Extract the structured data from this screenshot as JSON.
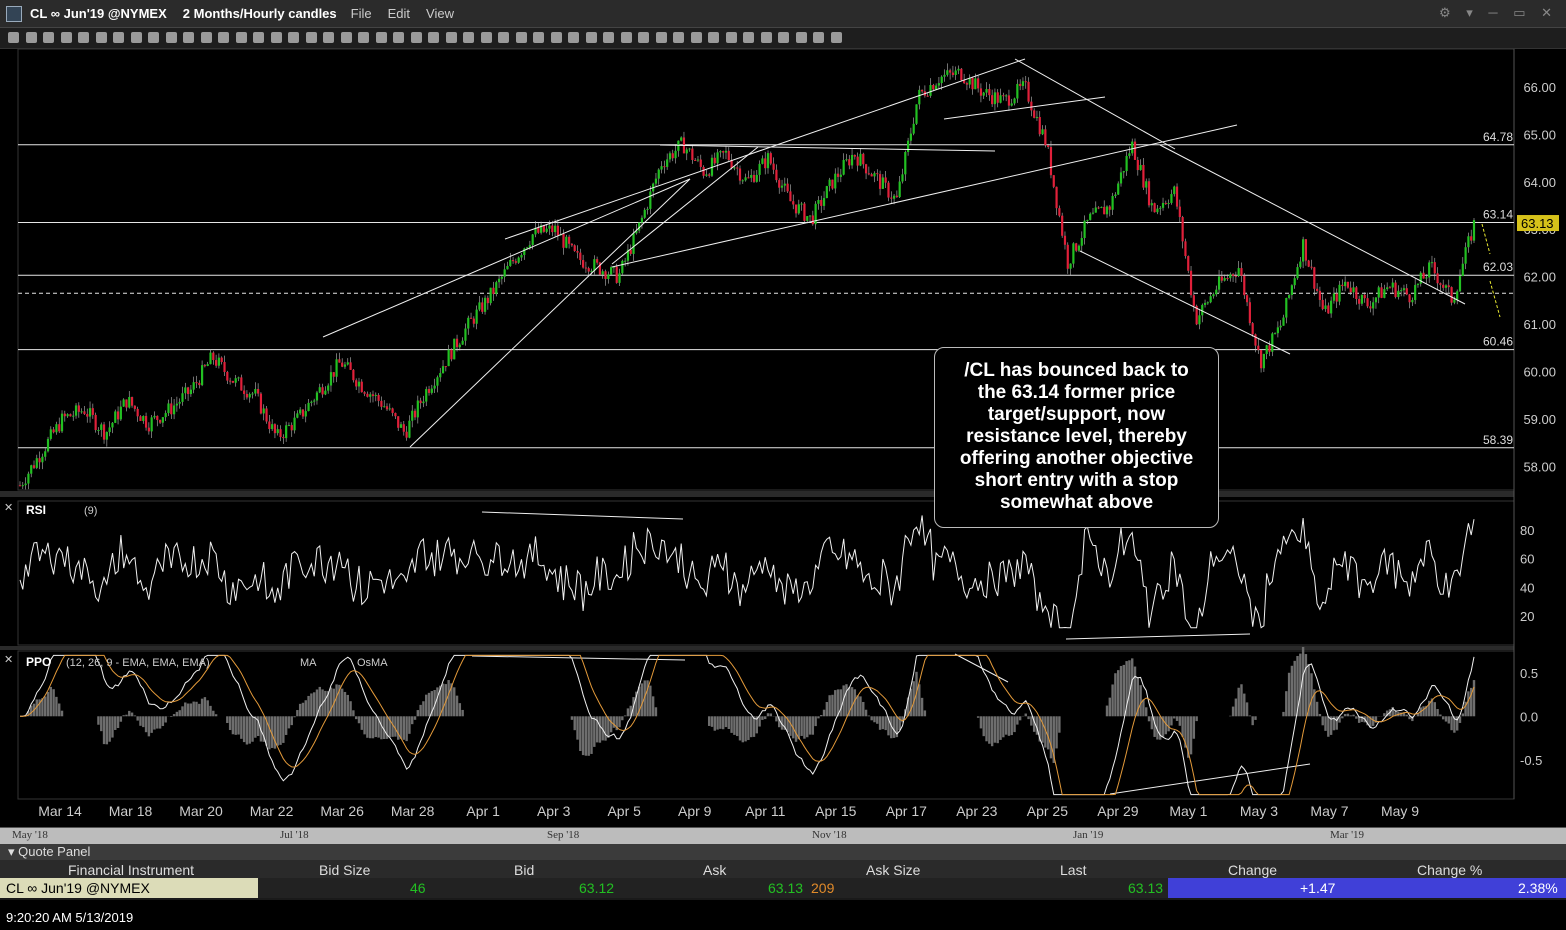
{
  "window": {
    "symbol": "CL ∞ Jun'19 @NYMEX",
    "timeframe": "2 Months/Hourly candles",
    "menus": [
      "File",
      "Edit",
      "View"
    ]
  },
  "colors": {
    "up": "#22c022",
    "down": "#e0203a",
    "bg": "#000000",
    "last_badge": "#d6c21a"
  },
  "chart_data": [
    {
      "type": "candlestick",
      "panel": "price",
      "ylim": [
        57.5,
        66.8
      ],
      "y_ticks": [
        "66.00",
        "65.00",
        "64.00",
        "63.00",
        "62.00",
        "61.00",
        "60.00",
        "59.00",
        "58.00"
      ],
      "x_tick_labels": [
        "Mar 14",
        "Mar 18",
        "Mar 20",
        "Mar 22",
        "Mar 26",
        "Mar 28",
        "Apr 1",
        "Apr 3",
        "Apr 5",
        "Apr 9",
        "Apr 11",
        "Apr 15",
        "Apr 17",
        "Apr 23",
        "Apr 25",
        "Apr 29",
        "May 1",
        "May 3",
        "May 7",
        "May 9"
      ],
      "close_path": [
        57.6,
        58.3,
        59.0,
        59.2,
        58.7,
        59.4,
        58.9,
        59.2,
        59.6,
        60.3,
        59.8,
        59.5,
        58.6,
        59.0,
        59.6,
        60.2,
        59.7,
        59.3,
        58.7,
        59.6,
        60.3,
        61.0,
        61.6,
        62.3,
        62.9,
        63.0,
        62.4,
        62.2,
        62.0,
        63.1,
        64.4,
        64.8,
        64.2,
        64.6,
        64.0,
        64.5,
        63.6,
        63.2,
        64.0,
        64.6,
        64.1,
        63.6,
        65.8,
        66.2,
        66.3,
        65.9,
        65.7,
        66.0,
        64.8,
        62.3,
        63.2,
        63.5,
        64.8,
        63.4,
        63.8,
        61.1,
        61.8,
        62.2,
        60.2,
        61.0,
        62.7,
        61.2,
        61.9,
        61.4,
        61.8,
        61.6,
        62.2,
        61.5,
        63.1
      ],
      "levels": [
        {
          "label": "64.78",
          "value": 64.78,
          "style": "solid"
        },
        {
          "label": "63.14",
          "value": 63.14,
          "style": "solid"
        },
        {
          "label": "62.03",
          "value": 62.03,
          "style": "solid"
        },
        {
          "label": "",
          "value": 61.65,
          "style": "dashed"
        },
        {
          "label": "60.46",
          "value": 60.46,
          "style": "solid"
        },
        {
          "label": "58.39",
          "value": 58.39,
          "style": "solid"
        }
      ],
      "last_price": "63.13"
    },
    {
      "type": "line",
      "panel": "rsi",
      "title": "RSI",
      "params": "(9)",
      "y_ticks": [
        "80",
        "60",
        "40",
        "20"
      ],
      "ylim": [
        0,
        100
      ]
    },
    {
      "type": "line",
      "panel": "ppo",
      "title": "PPO",
      "params": "(12, 26, 9 - EMA, EMA, EMA)",
      "legend": [
        "MA",
        "OsMA"
      ],
      "y_ticks": [
        "0.5",
        "0.0",
        "-0.5"
      ],
      "ylim": [
        -0.95,
        0.75
      ]
    }
  ],
  "annotation": "/CL has bounced back to the 63.14 former price target/support, now resistance level, thereby offering another objective short entry with a stop somewhat above",
  "overview_labels": [
    "May '18",
    "Jul '18",
    "Sep '18",
    "Nov '18",
    "Jan '19",
    "Mar '19"
  ],
  "quote_panel": {
    "title": "Quote Panel",
    "columns": [
      "Financial Instrument",
      "Bid Size",
      "Bid",
      "Ask",
      "Ask Size",
      "Last",
      "Change",
      "Change %"
    ],
    "row": {
      "instrument": "CL ∞ Jun'19 @NYMEX",
      "bid_size": "46",
      "bid": "63.12",
      "ask": "63.13",
      "ask_size": "209",
      "last": "63.13",
      "change": "+1.47",
      "change_pct": "2.38%"
    }
  },
  "status": {
    "timestamp": "9:20:20 AM 5/13/2019"
  }
}
